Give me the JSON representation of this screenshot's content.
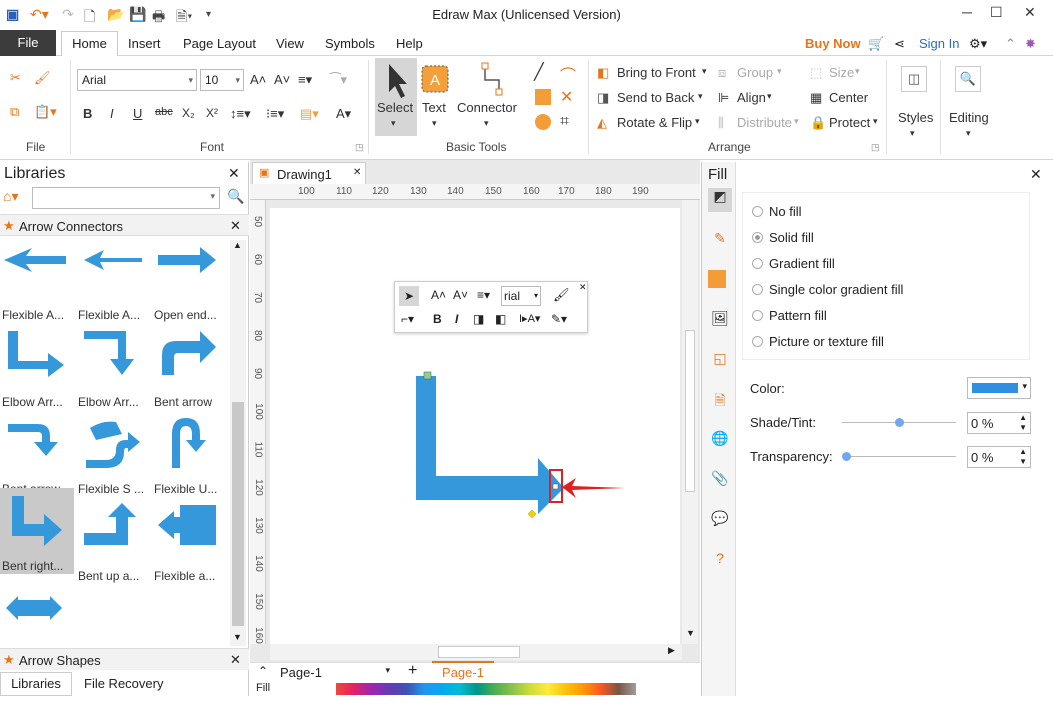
{
  "window": {
    "title": "Edraw Max (Unlicensed Version)"
  },
  "menu": {
    "file": "File",
    "tabs": [
      "Home",
      "Insert",
      "Page Layout",
      "View",
      "Symbols",
      "Help"
    ],
    "buy_now": "Buy Now",
    "sign_in": "Sign In"
  },
  "ribbon": {
    "groups": {
      "file": "File",
      "font": "Font",
      "basic_tools": "Basic Tools",
      "arrange": "Arrange"
    },
    "font_name": "Arial",
    "font_size": "10",
    "basic": {
      "select": "Select",
      "text": "Text",
      "connector": "Connector"
    },
    "arrange": {
      "bring_to_front": "Bring to Front",
      "send_to_back": "Send to Back",
      "rotate_flip": "Rotate & Flip",
      "group": "Group",
      "align": "Align",
      "distribute": "Distribute",
      "size": "Size",
      "center": "Center",
      "protect": "Protect"
    },
    "styles": "Styles",
    "editing": "Editing"
  },
  "libraries": {
    "title": "Libraries",
    "category": "Arrow Connectors",
    "shapes": [
      "Flexible A...",
      "Flexible A...",
      "Open end...",
      "Elbow Arr...",
      "Elbow Arr...",
      "Bent arrow",
      "Bent arrow",
      "Flexible S ...",
      "Flexible U...",
      "Bent right...",
      "Bent up a...",
      "Flexible a..."
    ],
    "bottom_category": "Arrow Shapes",
    "tabs": [
      "Libraries",
      "File Recovery"
    ]
  },
  "document": {
    "tab": "Drawing1",
    "page_select": "Page-1",
    "page_tab": "Page-1",
    "fill_label": "Fill"
  },
  "ruler": {
    "h": [
      "100",
      "110",
      "120",
      "130",
      "140",
      "150",
      "160",
      "170",
      "180",
      "190"
    ],
    "v": [
      "50",
      "60",
      "70",
      "80",
      "90",
      "100",
      "110",
      "120",
      "130",
      "140",
      "150",
      "160"
    ]
  },
  "floating_toolbar": {
    "font": "rial"
  },
  "fill_panel": {
    "title": "Fill",
    "options": [
      "No fill",
      "Solid fill",
      "Gradient fill",
      "Single color gradient fill",
      "Pattern fill",
      "Picture or texture fill"
    ],
    "selected": "Solid fill",
    "color_label": "Color:",
    "color": "#2f8fe0",
    "shade_label": "Shade/Tint:",
    "shade_value": "0 %",
    "transparency_label": "Transparency:",
    "transparency_value": "0 %"
  },
  "colors": {
    "accent": "#e8741a",
    "shape_blue": "#3498db",
    "highlight_red": "#e02020"
  }
}
